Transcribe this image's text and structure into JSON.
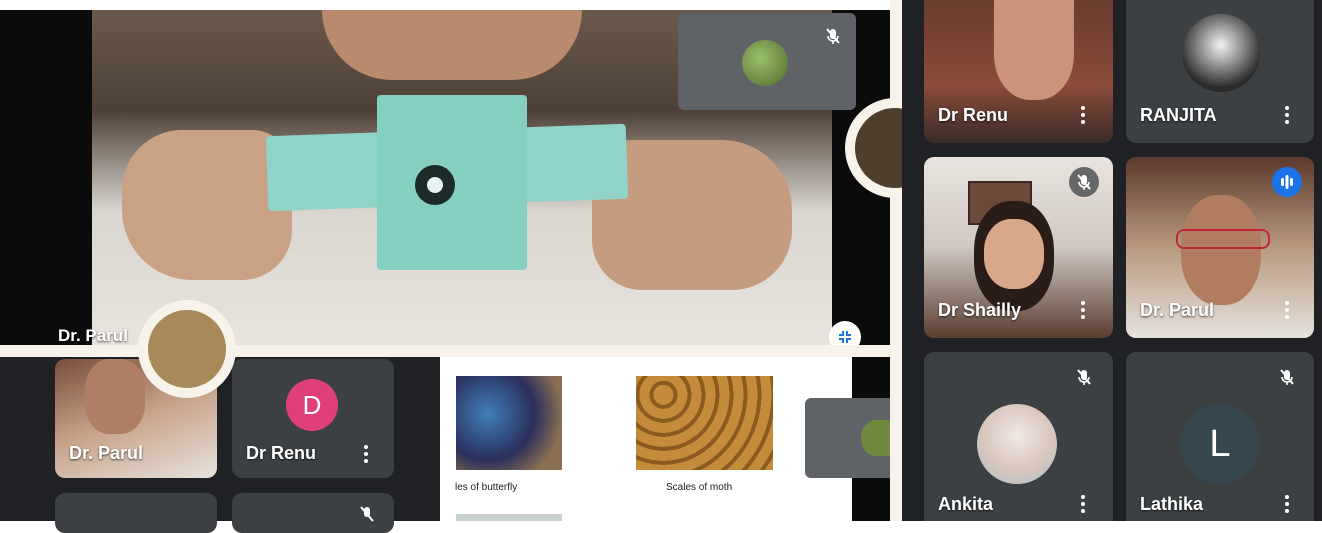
{
  "main_speaker": {
    "name": "Dr. Parul"
  },
  "grid": [
    {
      "name": "Dr Renu"
    },
    {
      "name": "RANJITA"
    },
    {
      "name": "Dr Shailly"
    },
    {
      "name": "Dr. Parul"
    },
    {
      "name": "Ankita"
    },
    {
      "name": "Lathika",
      "initial": "L"
    }
  ],
  "filmstrip": [
    {
      "name": "Dr. Parul"
    },
    {
      "name": "Dr Renu",
      "initial": "D"
    }
  ],
  "slide": {
    "caption_left": "les of butterfly",
    "caption_right": "Scales of moth"
  },
  "colors": {
    "meet_dark": "#3c4043",
    "avatar_pink": "#e0407a",
    "avatar_slate": "#37474f",
    "speaking_blue": "#1a73e8"
  }
}
